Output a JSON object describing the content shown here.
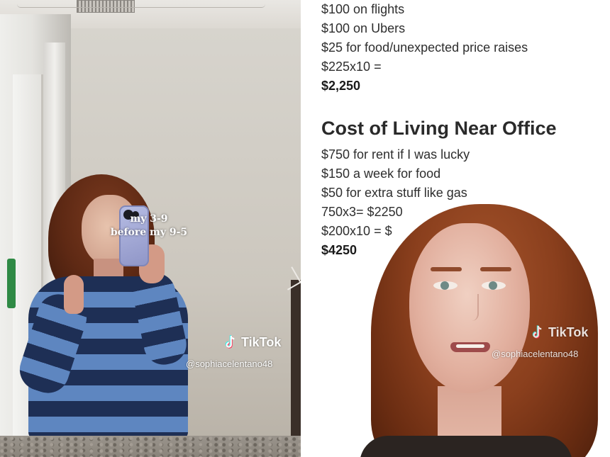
{
  "left_panel": {
    "caption_line1": "my 3-9",
    "caption_line2": "before my 9-5",
    "watermark": {
      "brand": "TikTok",
      "handle": "@sophiacelentano48"
    }
  },
  "right_panel": {
    "top_lines": [
      "$100 on flights",
      "$100 on Ubers",
      "$25 for food/unexpected price raises",
      "$225x10 ="
    ],
    "top_total": "$2,250",
    "heading": "Cost of Living Near Office",
    "bottom_lines": [
      "$750 for rent if I was lucky",
      "$150 a week for food",
      "$50 for extra stuff like gas",
      "750x3= $2250",
      "$200x10 = $"
    ],
    "bottom_total": "$4250",
    "watermark": {
      "brand": "TikTok",
      "handle": "@sophiacelentano48"
    }
  },
  "colors": {
    "sweater_dark": "#1e2f55",
    "sweater_light": "#5e86c0",
    "hair": "#8a3f1d",
    "tiktok_cyan": "#25f4ee",
    "tiktok_red": "#fe2c55"
  }
}
